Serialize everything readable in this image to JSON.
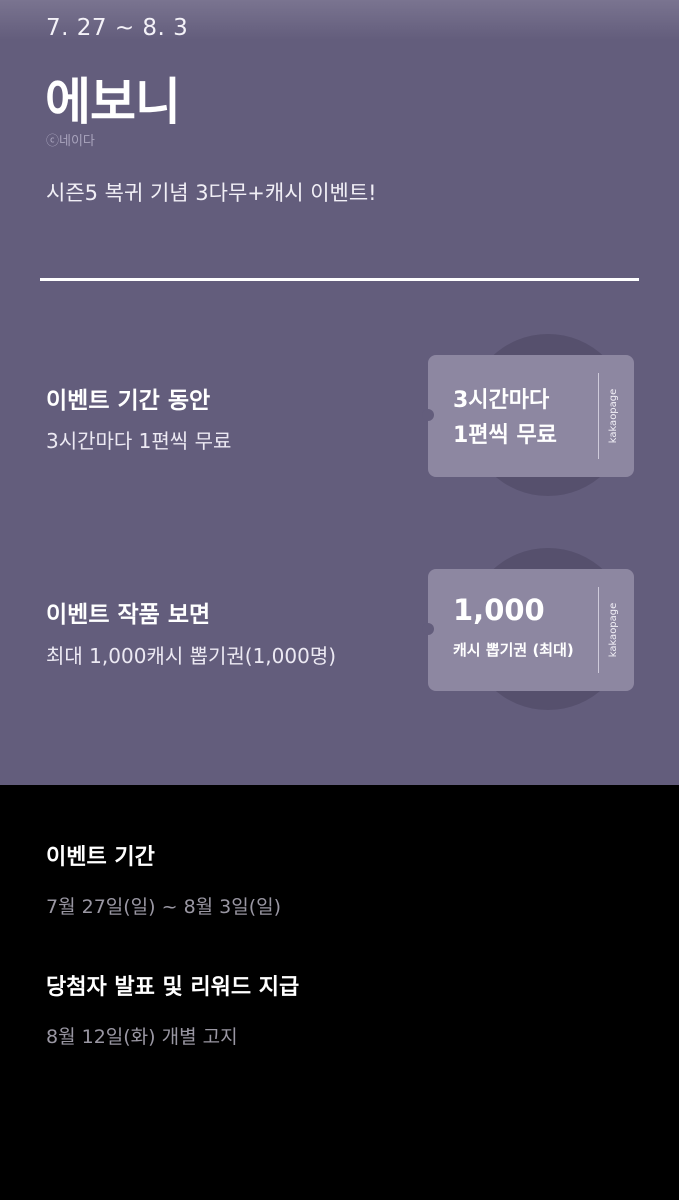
{
  "hero": {
    "date_range": "7. 27 ~ 8. 3",
    "title": "에보니",
    "copyright": "ⓒ네이다",
    "subtitle": "시즌5 복귀 기념 3다무+캐시 이벤트!"
  },
  "promos": [
    {
      "heading": "이벤트 기간 동안",
      "description": "3시간마다 1편씩 무료",
      "ticket": {
        "line1": "3시간마다",
        "line2": "1편씩 무료",
        "brand": "kakaopage"
      }
    },
    {
      "heading": "이벤트 작품 보면",
      "description": "최대 1,000캐시 뽑기권(1,000명)",
      "ticket": {
        "line1": "1,000",
        "line2": "캐시 뽑기권 (최대)",
        "brand": "kakaopage"
      }
    }
  ],
  "info": [
    {
      "heading": "이벤트 기간",
      "value": "7월 27일(일) ~ 8월 3일(일)"
    },
    {
      "heading": "당첨자 발표 및 리워드 지급",
      "value": "8월 12일(화) 개별 고지"
    }
  ],
  "colors": {
    "hero_background": "#635d7c",
    "ticket": "#8d87a1",
    "info_background": "#000000"
  }
}
